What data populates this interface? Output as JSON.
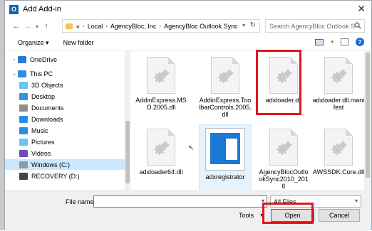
{
  "dialog": {
    "title": "Add Add-in",
    "app_icon_letter": "O"
  },
  "address": {
    "prefix": "«",
    "crumbs": [
      "Local",
      "AgencyBloc, Inc",
      "AgencyBloc Outlook Sync"
    ]
  },
  "search": {
    "placeholder": "Search AgencyBloc Outlook S"
  },
  "toolbar": {
    "organize": "Organize",
    "new_folder": "New folder"
  },
  "nav": {
    "items": [
      {
        "label": "OneDrive",
        "icon": "cloud-icon",
        "color": "#2a79d4"
      },
      {
        "label": "This PC",
        "icon": "computer-icon",
        "color": "#2b8ee6"
      },
      {
        "label": "3D Objects",
        "icon": "folder-3d-icon",
        "color": "#6cc1f5"
      },
      {
        "label": "Desktop",
        "icon": "desktop-icon",
        "color": "#3d8fd8"
      },
      {
        "label": "Documents",
        "icon": "documents-icon",
        "color": "#8e8e8e"
      },
      {
        "label": "Downloads",
        "icon": "downloads-icon",
        "color": "#2b8ee6"
      },
      {
        "label": "Music",
        "icon": "music-icon",
        "color": "#2b8ee6"
      },
      {
        "label": "Pictures",
        "icon": "pictures-icon",
        "color": "#6cc1f5"
      },
      {
        "label": "Videos",
        "icon": "videos-icon",
        "color": "#6a4fb8"
      },
      {
        "label": "Windows (C:)",
        "icon": "drive-icon",
        "color": "#8d9aa8"
      },
      {
        "label": "RECOVERY (D:)",
        "icon": "drive-icon",
        "color": "#444"
      }
    ]
  },
  "files": [
    {
      "name": "AddinExpress.MSO.2005.dll"
    },
    {
      "name": "AddinExpress.ToolbarControls.2005.dll"
    },
    {
      "name": "adxloader.dll"
    },
    {
      "name": "adxloader.dll.manifest"
    },
    {
      "name": "adxloader64.dll"
    },
    {
      "name": "adxregistrator"
    },
    {
      "name": "AgencyBlocOutlookSync2010_2016"
    },
    {
      "name": "AWSSDK.Core.dll"
    }
  ],
  "bottom": {
    "file_name_label": "File name:",
    "file_name_value": "",
    "file_type": "All Files",
    "tools": "Tools",
    "open": "Open",
    "cancel": "Cancel"
  },
  "colors": {
    "highlight": "#e0161e",
    "selected": "#cce8ff"
  }
}
